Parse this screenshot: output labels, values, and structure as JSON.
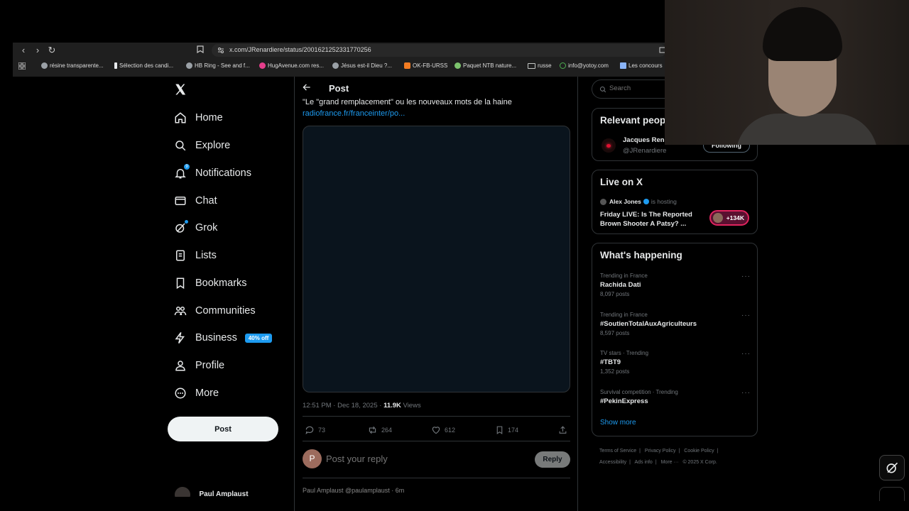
{
  "browser": {
    "url": "x.com/JRenardiere/status/2001621252331770256",
    "bookmarks": [
      {
        "label": "résine transparente...",
        "color": "#9aa0a6"
      },
      {
        "label": "Sélection des candi...",
        "color": "#e8eaed"
      },
      {
        "label": "HB Ring - See and f...",
        "color": "#9aa0a6"
      },
      {
        "label": "HugAvenue.com res...",
        "color": "#e53e8b"
      },
      {
        "label": "Jésus est-il Dieu ?...",
        "color": "#9aa0a6"
      },
      {
        "label": "OK-FB-URSS",
        "color": "#f27c22"
      },
      {
        "label": "Paquet NTB nature...",
        "color": "#7cc36d"
      },
      {
        "label": "russe",
        "color": "#c4c7c5"
      },
      {
        "label": "info@yotoy.com",
        "color": "#4caf50"
      },
      {
        "label": "Les concours",
        "color": "#8ab4f8"
      }
    ]
  },
  "nav": {
    "items": [
      {
        "label": "Home",
        "icon": "home-icon"
      },
      {
        "label": "Explore",
        "icon": "search-icon"
      },
      {
        "label": "Notifications",
        "icon": "bell-icon",
        "badge": "9"
      },
      {
        "label": "Chat",
        "icon": "mail-icon"
      },
      {
        "label": "Grok",
        "icon": "grok-icon"
      },
      {
        "label": "Lists",
        "icon": "list-icon"
      },
      {
        "label": "Bookmarks",
        "icon": "bookmark-icon"
      },
      {
        "label": "Communities",
        "icon": "communities-icon"
      },
      {
        "label": "Business",
        "icon": "lightning-icon",
        "badge": "40% off"
      },
      {
        "label": "Profile",
        "icon": "person-icon"
      },
      {
        "label": "More",
        "icon": "more-circle-icon"
      }
    ],
    "post_button": "Post",
    "account_stub": "Paul Amplaust"
  },
  "post": {
    "header": "Post",
    "text": "\"Le \"grand remplacement\" ou les nouveaux mots de la haine",
    "link": "radiofrance.fr/franceinter/po...",
    "time": "12:51 PM · Dec 18, 2025 · ",
    "views_count": "11.9K",
    "views_label": " Views",
    "replies": "73",
    "reposts": "264",
    "likes": "612",
    "bookmarks": "174",
    "reply_placeholder": "Post your reply",
    "reply_button": "Reply",
    "avatar_letter": "P",
    "next_reply_stub": "Paul Amplaust @paulamplaust · 6m"
  },
  "sidebar": {
    "search_placeholder": "Search",
    "relevant": {
      "title": "Relevant people",
      "name": "Jacques Renardière",
      "handle": "@JRenardiere",
      "button": "Following"
    },
    "live": {
      "title": "Live on X",
      "host": "Alex Jones",
      "hosting_label": "is hosting",
      "show_title": "Friday LIVE: Is The Reported Brown Shooter A Patsy? ...",
      "listeners": "+134K"
    },
    "happening": {
      "title": "What's happening",
      "trends": [
        {
          "context": "Trending in France",
          "name": "Rachida Dati",
          "count": "8,097 posts"
        },
        {
          "context": "Trending in France",
          "name": "#SoutienTotalAuxAgriculteurs",
          "count": "8,597 posts"
        },
        {
          "context": "TV stars · Trending",
          "name": "#TBT9",
          "count": "1,352 posts"
        },
        {
          "context": "Survival competition · Trending",
          "name": "#PekinExpress",
          "count": ""
        }
      ],
      "show_more": "Show more"
    },
    "footer": [
      "Terms of Service",
      "|",
      "Privacy Policy",
      "|",
      "Cookie Policy",
      "|",
      "Accessibility",
      "|",
      "Ads info",
      "|",
      "More ···",
      "© 2025 X Corp."
    ]
  },
  "colors": {
    "accent": "#1d9bf0",
    "live_red": "#e0245e",
    "background": "#000000"
  }
}
